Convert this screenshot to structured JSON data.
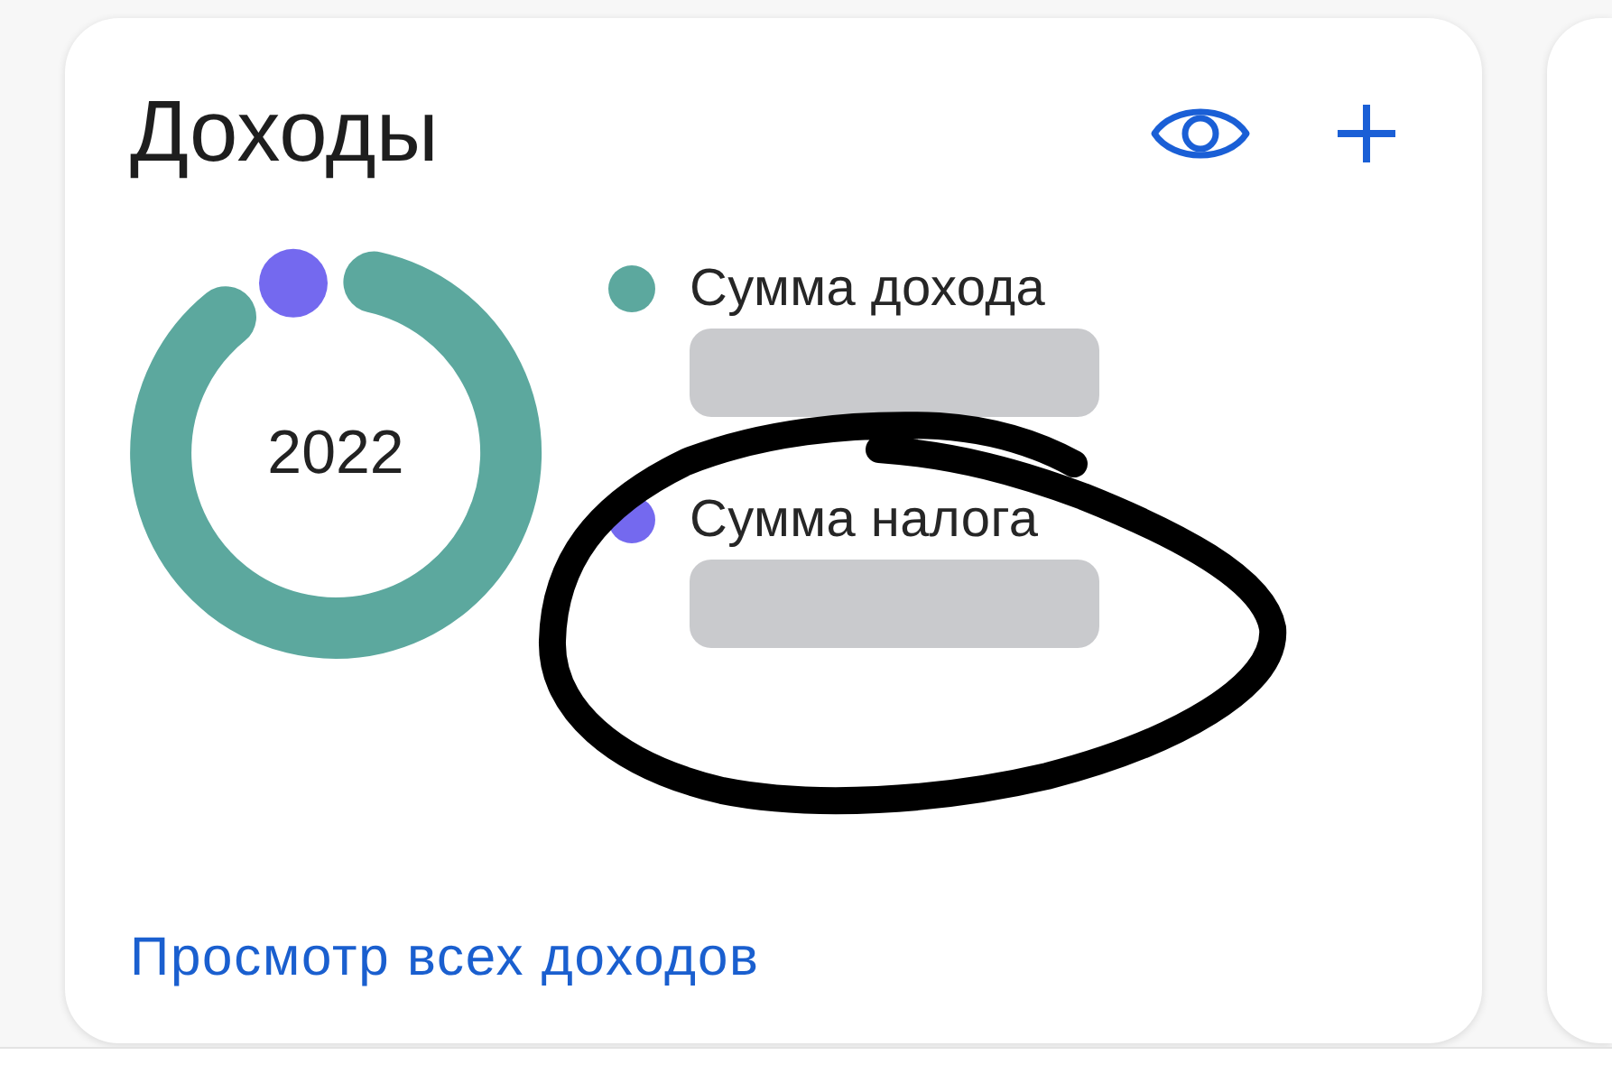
{
  "income_card": {
    "title": "Доходы",
    "donut": {
      "center_label": "2022"
    },
    "legend": [
      {
        "label": "Сумма дохода",
        "color": "#5ca89e",
        "masked": true
      },
      {
        "label": "Сумма налога",
        "color": "#7469ef",
        "masked": true
      }
    ],
    "link": "Просмотр всех доходов"
  }
}
